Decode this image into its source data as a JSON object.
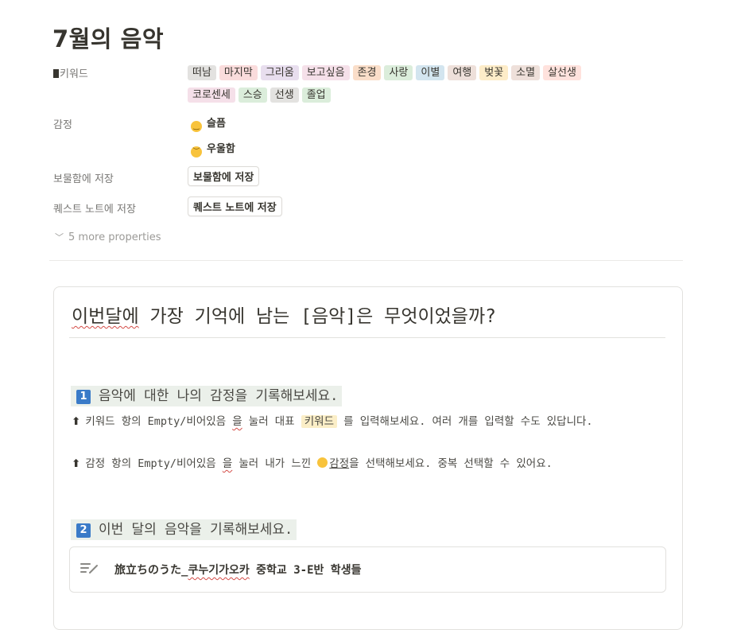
{
  "page": {
    "title": "7월의 음악"
  },
  "properties": {
    "keywords_label": "키워드",
    "keywords": [
      {
        "label": "떠남",
        "color": "#e3e2e0"
      },
      {
        "label": "마지막",
        "color": "#fadcdc"
      },
      {
        "label": "그리움",
        "color": "#e8deee"
      },
      {
        "label": "보고싶음",
        "color": "#f5e0e9"
      },
      {
        "label": "존경",
        "color": "#fadec9"
      },
      {
        "label": "사랑",
        "color": "#dbeddb"
      },
      {
        "label": "이별",
        "color": "#d3e5ef"
      },
      {
        "label": "여행",
        "color": "#eee0da"
      },
      {
        "label": "벚꽃",
        "color": "#fdecc8"
      },
      {
        "label": "소멸",
        "color": "#eee0da"
      },
      {
        "label": "살선생",
        "color": "#ffe2dd"
      },
      {
        "label": "코로센세",
        "color": "#f5e0e9"
      },
      {
        "label": "스승",
        "color": "#dbeddb"
      },
      {
        "label": "선생",
        "color": "#e3e2e0"
      },
      {
        "label": "졸업",
        "color": "#dbeddb"
      }
    ],
    "emotion_label": "감정",
    "emotions": [
      "슬픔",
      "우울함"
    ],
    "treasure_label": "보물함에 저장",
    "treasure_button": "보물함에 저장",
    "quest_label": "퀘스트 노트에 저장",
    "quest_button": "퀘스트 노트에 저장",
    "more_properties": "5 more properties"
  },
  "card": {
    "question_part1": "이번달에",
    "question_part2": " 가장 기억에 남는 [음악]은 무엇이었을까?",
    "step1": {
      "num": "1",
      "text": "음악에 대한 나의 감정을 기록해보세요."
    },
    "instr1": {
      "a": "키워드 항의 Empty/비어있음 ",
      "b": "을",
      "c": " 눌러 대표 ",
      "d": "키워드",
      "e": " 를 입력해보세요. 여러 개를 입력할 수도 있답니다."
    },
    "instr2": {
      "a": "감정 항의 Empty/비어있음 ",
      "b": "을",
      "c": " 눌러 내가 느낀 ",
      "d": "감정",
      "e": "을 선택해보세요. 중복 선택할 수 있어요."
    },
    "step2": {
      "num": "2",
      "text": "이번 달의 음악을 기록해보세요."
    },
    "song": {
      "prefix": "旅立ちのうた_",
      "underlined": "쿠누기가오카",
      "suffix": " 중학교 3-E반 학생들"
    }
  },
  "icons": {
    "arrow": "⬆",
    "note": "edit-note-icon",
    "chevron": "chevron-down-icon"
  }
}
